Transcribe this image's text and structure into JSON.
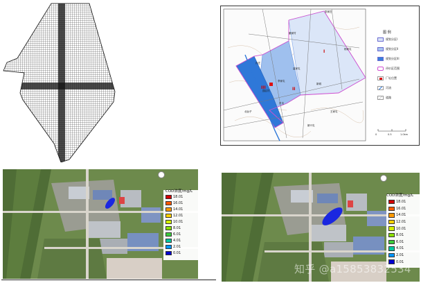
{
  "zone_map": {
    "legend_title": "图 例",
    "legend_items": [
      {
        "label": "规划分区I",
        "color": "#d9e4f7"
      },
      {
        "label": "规划分区II",
        "color": "#a6c4ef"
      },
      {
        "label": "规划分区III",
        "color": "#3a7fdc"
      },
      {
        "label": "评价区范围",
        "color": "#ffffff"
      },
      {
        "label": "厂址位置",
        "color": "#ffffff"
      },
      {
        "label": "河流",
        "color": "#ffffff"
      },
      {
        "label": "道路",
        "color": "#ffffff"
      }
    ],
    "scale_labels": [
      "0",
      "0.5",
      "1.0km"
    ],
    "place_labels": [
      "张家庄",
      "董家村",
      "孙庄",
      "高家屯",
      "李家屯",
      "新城",
      "东屯",
      "园区村",
      "新兴屯",
      "王家屯",
      "北台子",
      "杨家屯"
    ],
    "zone_labels": [
      "I",
      "II",
      "III"
    ],
    "colors": {
      "zone1": "#dbe6f8",
      "zone2": "#9fc0ee",
      "zone3": "#2f78d8",
      "boundary": "#d04fd0",
      "road": "#777777"
    }
  },
  "concentration_maps": [
    {
      "legend_title": "COD浓度/mg/L",
      "values": [
        "18.01",
        "16.01",
        "14.01",
        "12.01",
        "10.01",
        "8.01",
        "6.01",
        "4.01",
        "2.01",
        "0.01"
      ]
    },
    {
      "legend_title": "COD浓度/mg/L",
      "values": [
        "18.01",
        "16.01",
        "14.01",
        "12.01",
        "10.01",
        "8.01",
        "6.01",
        "4.01",
        "2.01",
        "0.01"
      ]
    }
  ],
  "legend_colors": [
    "#d40000",
    "#ff5a00",
    "#ff9a00",
    "#ffd200",
    "#d4f000",
    "#8ce000",
    "#3ccc3c",
    "#00c8a0",
    "#0096ff",
    "#0000d0"
  ],
  "watermark": "知乎 @a15853832534"
}
